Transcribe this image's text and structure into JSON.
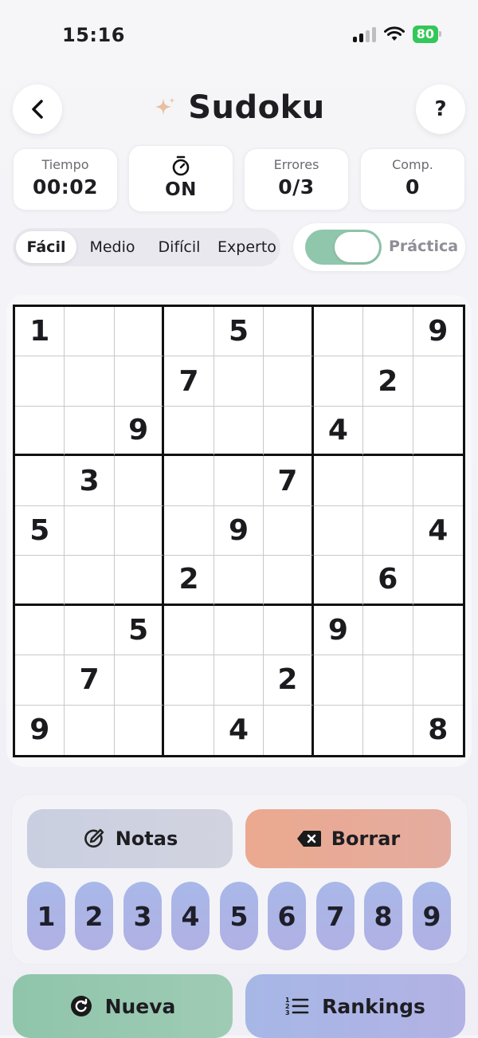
{
  "status": {
    "time": "15:16",
    "battery": "80"
  },
  "header": {
    "title": "Sudoku",
    "back_icon": "chevron-left-icon",
    "help_label": "?",
    "sparkle_color": "#e7b99a"
  },
  "stats": [
    {
      "label": "Tiempo",
      "value": "00:02"
    },
    {
      "label": "",
      "value": "ON",
      "icon": "timer-icon"
    },
    {
      "label": "Errores",
      "value": "0/3"
    },
    {
      "label": "Comp.",
      "value": "0"
    }
  ],
  "difficulty": {
    "options": [
      "Fácil",
      "Medio",
      "Difícil",
      "Experto"
    ],
    "selected": "Fácil"
  },
  "practice": {
    "label": "Práctica",
    "enabled": true
  },
  "board": [
    [
      "1",
      "",
      "",
      "",
      "5",
      "",
      "",
      "",
      "9"
    ],
    [
      "",
      "",
      "",
      "7",
      "",
      "",
      "",
      "2",
      ""
    ],
    [
      "",
      "",
      "9",
      "",
      "",
      "",
      "4",
      "",
      ""
    ],
    [
      "",
      "3",
      "",
      "",
      "",
      "7",
      "",
      "",
      ""
    ],
    [
      "5",
      "",
      "",
      "",
      "9",
      "",
      "",
      "",
      "4"
    ],
    [
      "",
      "",
      "",
      "2",
      "",
      "",
      "",
      "6",
      ""
    ],
    [
      "",
      "",
      "5",
      "",
      "",
      "",
      "9",
      "",
      ""
    ],
    [
      "",
      "7",
      "",
      "",
      "",
      "2",
      "",
      "",
      ""
    ],
    [
      "9",
      "",
      "",
      "",
      "4",
      "",
      "",
      "",
      "8"
    ]
  ],
  "actions": {
    "notes": "Notas",
    "erase": "Borrar"
  },
  "numbers": [
    "1",
    "2",
    "3",
    "4",
    "5",
    "6",
    "7",
    "8",
    "9"
  ],
  "bottom": {
    "new": "Nueva",
    "rankings": "Rankings"
  },
  "colors": {
    "notes_bg": "#cdd2e2",
    "erase_bg": "#e8ab98",
    "new_bg": "#92c8ad",
    "rankings_bg": "#aab6e6",
    "toggle_on": "#8fc6ac"
  }
}
